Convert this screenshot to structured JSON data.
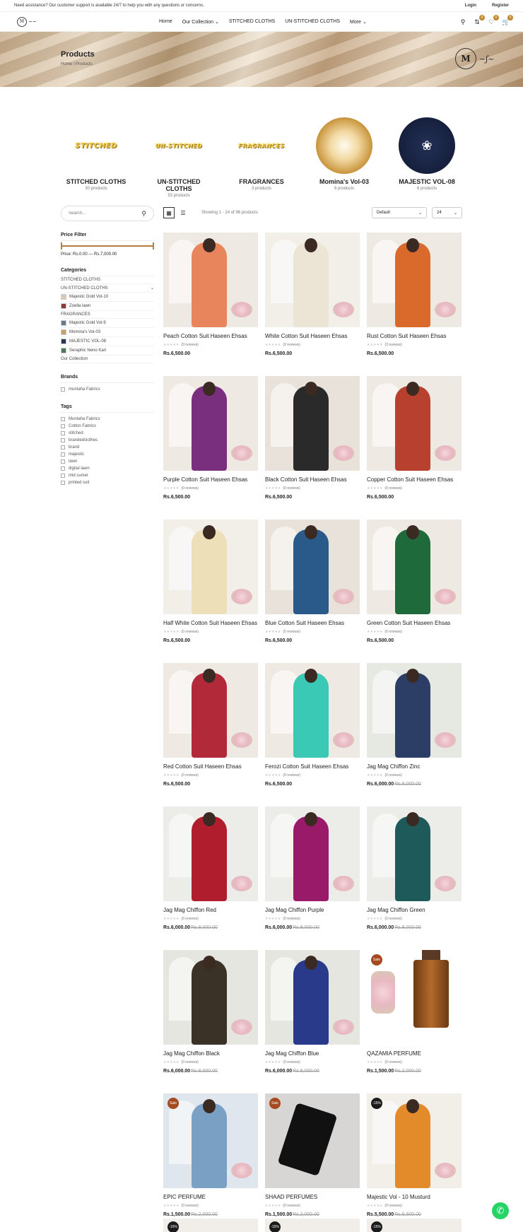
{
  "notice": {
    "text": "Need assistance? Our customer support is available 24/7 to help you with any questions or concerns.",
    "login": "Login",
    "register": "Register"
  },
  "nav": {
    "menu": [
      "Home",
      "Our Collection ⌄",
      "STITCHED CLOTHS",
      "UN-STITCHED CLOTHS",
      "More ⌄"
    ],
    "compare_count": "0",
    "wishlist_count": "0",
    "cart_count": "0"
  },
  "hero": {
    "title": "Products",
    "breadcrumb_home": "Home",
    "breadcrumb_sep": "/",
    "breadcrumb_current": "Products"
  },
  "categories": [
    {
      "word": "STITCHED",
      "title": "STITCHED CLOTHS",
      "count": "30 products"
    },
    {
      "word": "UN-STITCHED",
      "title": "UN-STITCHED CLOTHS",
      "count": "53 products"
    },
    {
      "word": "FRAGRANCES",
      "title": "FRAGRANCES",
      "count": "3 products"
    },
    {
      "word": "",
      "title": "Momina's Vol-03",
      "count": "6 products"
    },
    {
      "word": "",
      "title": "MAJESTIC VOL-08",
      "count": "8 products"
    }
  ],
  "sidebar": {
    "search_placeholder": "Search...",
    "price_heading": "Price Filter",
    "price_label": "Price: Rs.0.00 — Rs.7,000.00",
    "categories_heading": "Categories",
    "categories": [
      {
        "label": "STITCHED CLOTHS",
        "thumb": false,
        "chevron": false
      },
      {
        "label": "UN-STITCHED CLOTHS",
        "thumb": false,
        "chevron": true
      },
      {
        "label": "Majestic Gold Vol-10",
        "thumb": true
      },
      {
        "label": "Zoella lawn",
        "thumb": true
      },
      {
        "label": "FRAGRANCES",
        "thumb": false
      },
      {
        "label": "Majestic Gold Vol-9",
        "thumb": true
      },
      {
        "label": "Momina's Vol-03",
        "thumb": true
      },
      {
        "label": "MAJESTIC VOL-08",
        "thumb": true
      },
      {
        "label": "Seraphic Neno Kari",
        "thumb": true
      },
      {
        "label": "Our Collection",
        "thumb": false
      }
    ],
    "brands_heading": "Brands",
    "brands": [
      "muntaha Fabrics"
    ],
    "tags_heading": "Tags",
    "tags": [
      "Muntaha Fabrics",
      "Cotton Fabrics",
      "stitched",
      "brandedclothes",
      "brand",
      "majestic",
      "lawn",
      "digital lawn",
      "mid sumer",
      "printed suit"
    ]
  },
  "toolbar": {
    "showing": "Showing 1 - 24 of 96 products",
    "sort_value": "Default",
    "per_page_value": "24"
  },
  "products": [
    {
      "name": "Peach Cotton Suit Haseen Ehsas",
      "reviews": "(0 reviews)",
      "price": "Rs.6,500.00",
      "old": "",
      "tag": "",
      "color": "#e8855c",
      "bg": "#efe9e3"
    },
    {
      "name": "White Cotton Suit Haseen Ehsas",
      "reviews": "(0 reviews)",
      "price": "Rs.6,500.00",
      "old": "",
      "tag": "",
      "color": "#ece5d6",
      "bg": "#f2eee8"
    },
    {
      "name": "Rust Cotton Suit Haseen Ehsas",
      "reviews": "(0 reviews)",
      "price": "Rs.6,500.00",
      "old": "",
      "tag": "",
      "color": "#d96a2b",
      "bg": "#efe9e3"
    },
    {
      "name": "Purple Cotton Suit Haseen Ehsas",
      "reviews": "(0 reviews)",
      "price": "Rs.6,500.00",
      "old": "",
      "tag": "",
      "color": "#7a2f7e",
      "bg": "#efe9e3"
    },
    {
      "name": "Black Cotton Suit Haseen Ehsas",
      "reviews": "(0 reviews)",
      "price": "Rs.6,500.00",
      "old": "",
      "tag": "",
      "color": "#2a2a2a",
      "bg": "#e8e2da"
    },
    {
      "name": "Copper Cotton Suit Haseen Ehsas",
      "reviews": "(0 reviews)",
      "price": "Rs.6,500.00",
      "old": "",
      "tag": "",
      "color": "#b8402e",
      "bg": "#efe9e3"
    },
    {
      "name": "Half White Cotton Suit Haseen Ehsas",
      "reviews": "(0 reviews)",
      "price": "Rs.6,500.00",
      "old": "",
      "tag": "",
      "color": "#ede0b8",
      "bg": "#f2eee8"
    },
    {
      "name": "Blue Cotton Suit Haseen Ehsas",
      "reviews": "(0 reviews)",
      "price": "Rs.6,500.00",
      "old": "",
      "tag": "",
      "color": "#2a5a8a",
      "bg": "#e8e2da"
    },
    {
      "name": "Green Cotton Suit Haseen Ehsas",
      "reviews": "(0 reviews)",
      "price": "Rs.6,500.00",
      "old": "",
      "tag": "",
      "color": "#1e6a3a",
      "bg": "#efe9e3"
    },
    {
      "name": "Red Cotton Suit Haseen Ehsas",
      "reviews": "(0 reviews)",
      "price": "Rs.6,500.00",
      "old": "",
      "tag": "",
      "color": "#b22a3a",
      "bg": "#efe9e3"
    },
    {
      "name": "Ferozi Cotton Suit Haseen Ehsas",
      "reviews": "(0 reviews)",
      "price": "Rs.6,500.00",
      "old": "",
      "tag": "",
      "color": "#3ac9b4",
      "bg": "#efe9e3"
    },
    {
      "name": "Jag Mag Chiffon Zinc",
      "reviews": "(0 reviews)",
      "price": "Rs.6,000.00",
      "old": "Rs.8,000.00",
      "tag": "",
      "color": "#2c3e66",
      "bg": "#e6e8e2"
    },
    {
      "name": "Jag Mag Chiffon Red",
      "reviews": "(0 reviews)",
      "price": "Rs.6,000.00",
      "old": "Rs.8,000.00",
      "tag": "",
      "color": "#b01e2e",
      "bg": "#ecece8"
    },
    {
      "name": "Jag Mag Chiffon Purple",
      "reviews": "(0 reviews)",
      "price": "Rs.6,000.00",
      "old": "Rs.8,000.00",
      "tag": "",
      "color": "#9a1a6a",
      "bg": "#ecece8"
    },
    {
      "name": "Jag Mag Chiffon Green",
      "reviews": "(0 reviews)",
      "price": "Rs.6,000.00",
      "old": "Rs.8,000.00",
      "tag": "",
      "color": "#1e5a5a",
      "bg": "#ecece8"
    },
    {
      "name": "Jag Mag Chiffon Black",
      "reviews": "(0 reviews)",
      "price": "Rs.6,000.00",
      "old": "Rs.8,000.00",
      "tag": "",
      "color": "#3a3226",
      "bg": "#e6e6e0"
    },
    {
      "name": "Jag Mag Chiffon Blue",
      "reviews": "(0 reviews)",
      "price": "Rs.6,000.00",
      "old": "Rs.8,000.00",
      "tag": "",
      "color": "#2a3a8a",
      "bg": "#e6e6e0"
    },
    {
      "name": "QAZAMIA PERFUME",
      "reviews": "(0 reviews)",
      "price": "Rs.1,500.00",
      "old": "Rs.2,000.00",
      "tag": "Sale",
      "color": "perfume",
      "bg": "#ffffff"
    },
    {
      "name": "EPIC PERFUME",
      "reviews": "(0 reviews)",
      "price": "Rs.1,500.00",
      "old": "Rs.2,000.00",
      "tag": "Sale",
      "color": "#7aa0c4",
      "bg": "#dfe6ee"
    },
    {
      "name": "SHAAD PERFUMES",
      "reviews": "(0 reviews)",
      "price": "Rs.1,500.00",
      "old": "Rs.2,000.00",
      "tag": "Sale",
      "color": "bottle",
      "bg": "#d8d6d4"
    },
    {
      "name": "Majestic Vol - 10 Musturd",
      "reviews": "(0 reviews)",
      "price": "Rs.5,500.00",
      "old": "Rs.6,500.00",
      "tag": "-15%",
      "color": "#e38a2a",
      "bg": "#f2eee8"
    }
  ],
  "partial_row_tags": [
    "-15%",
    "-15%",
    "-15%"
  ]
}
